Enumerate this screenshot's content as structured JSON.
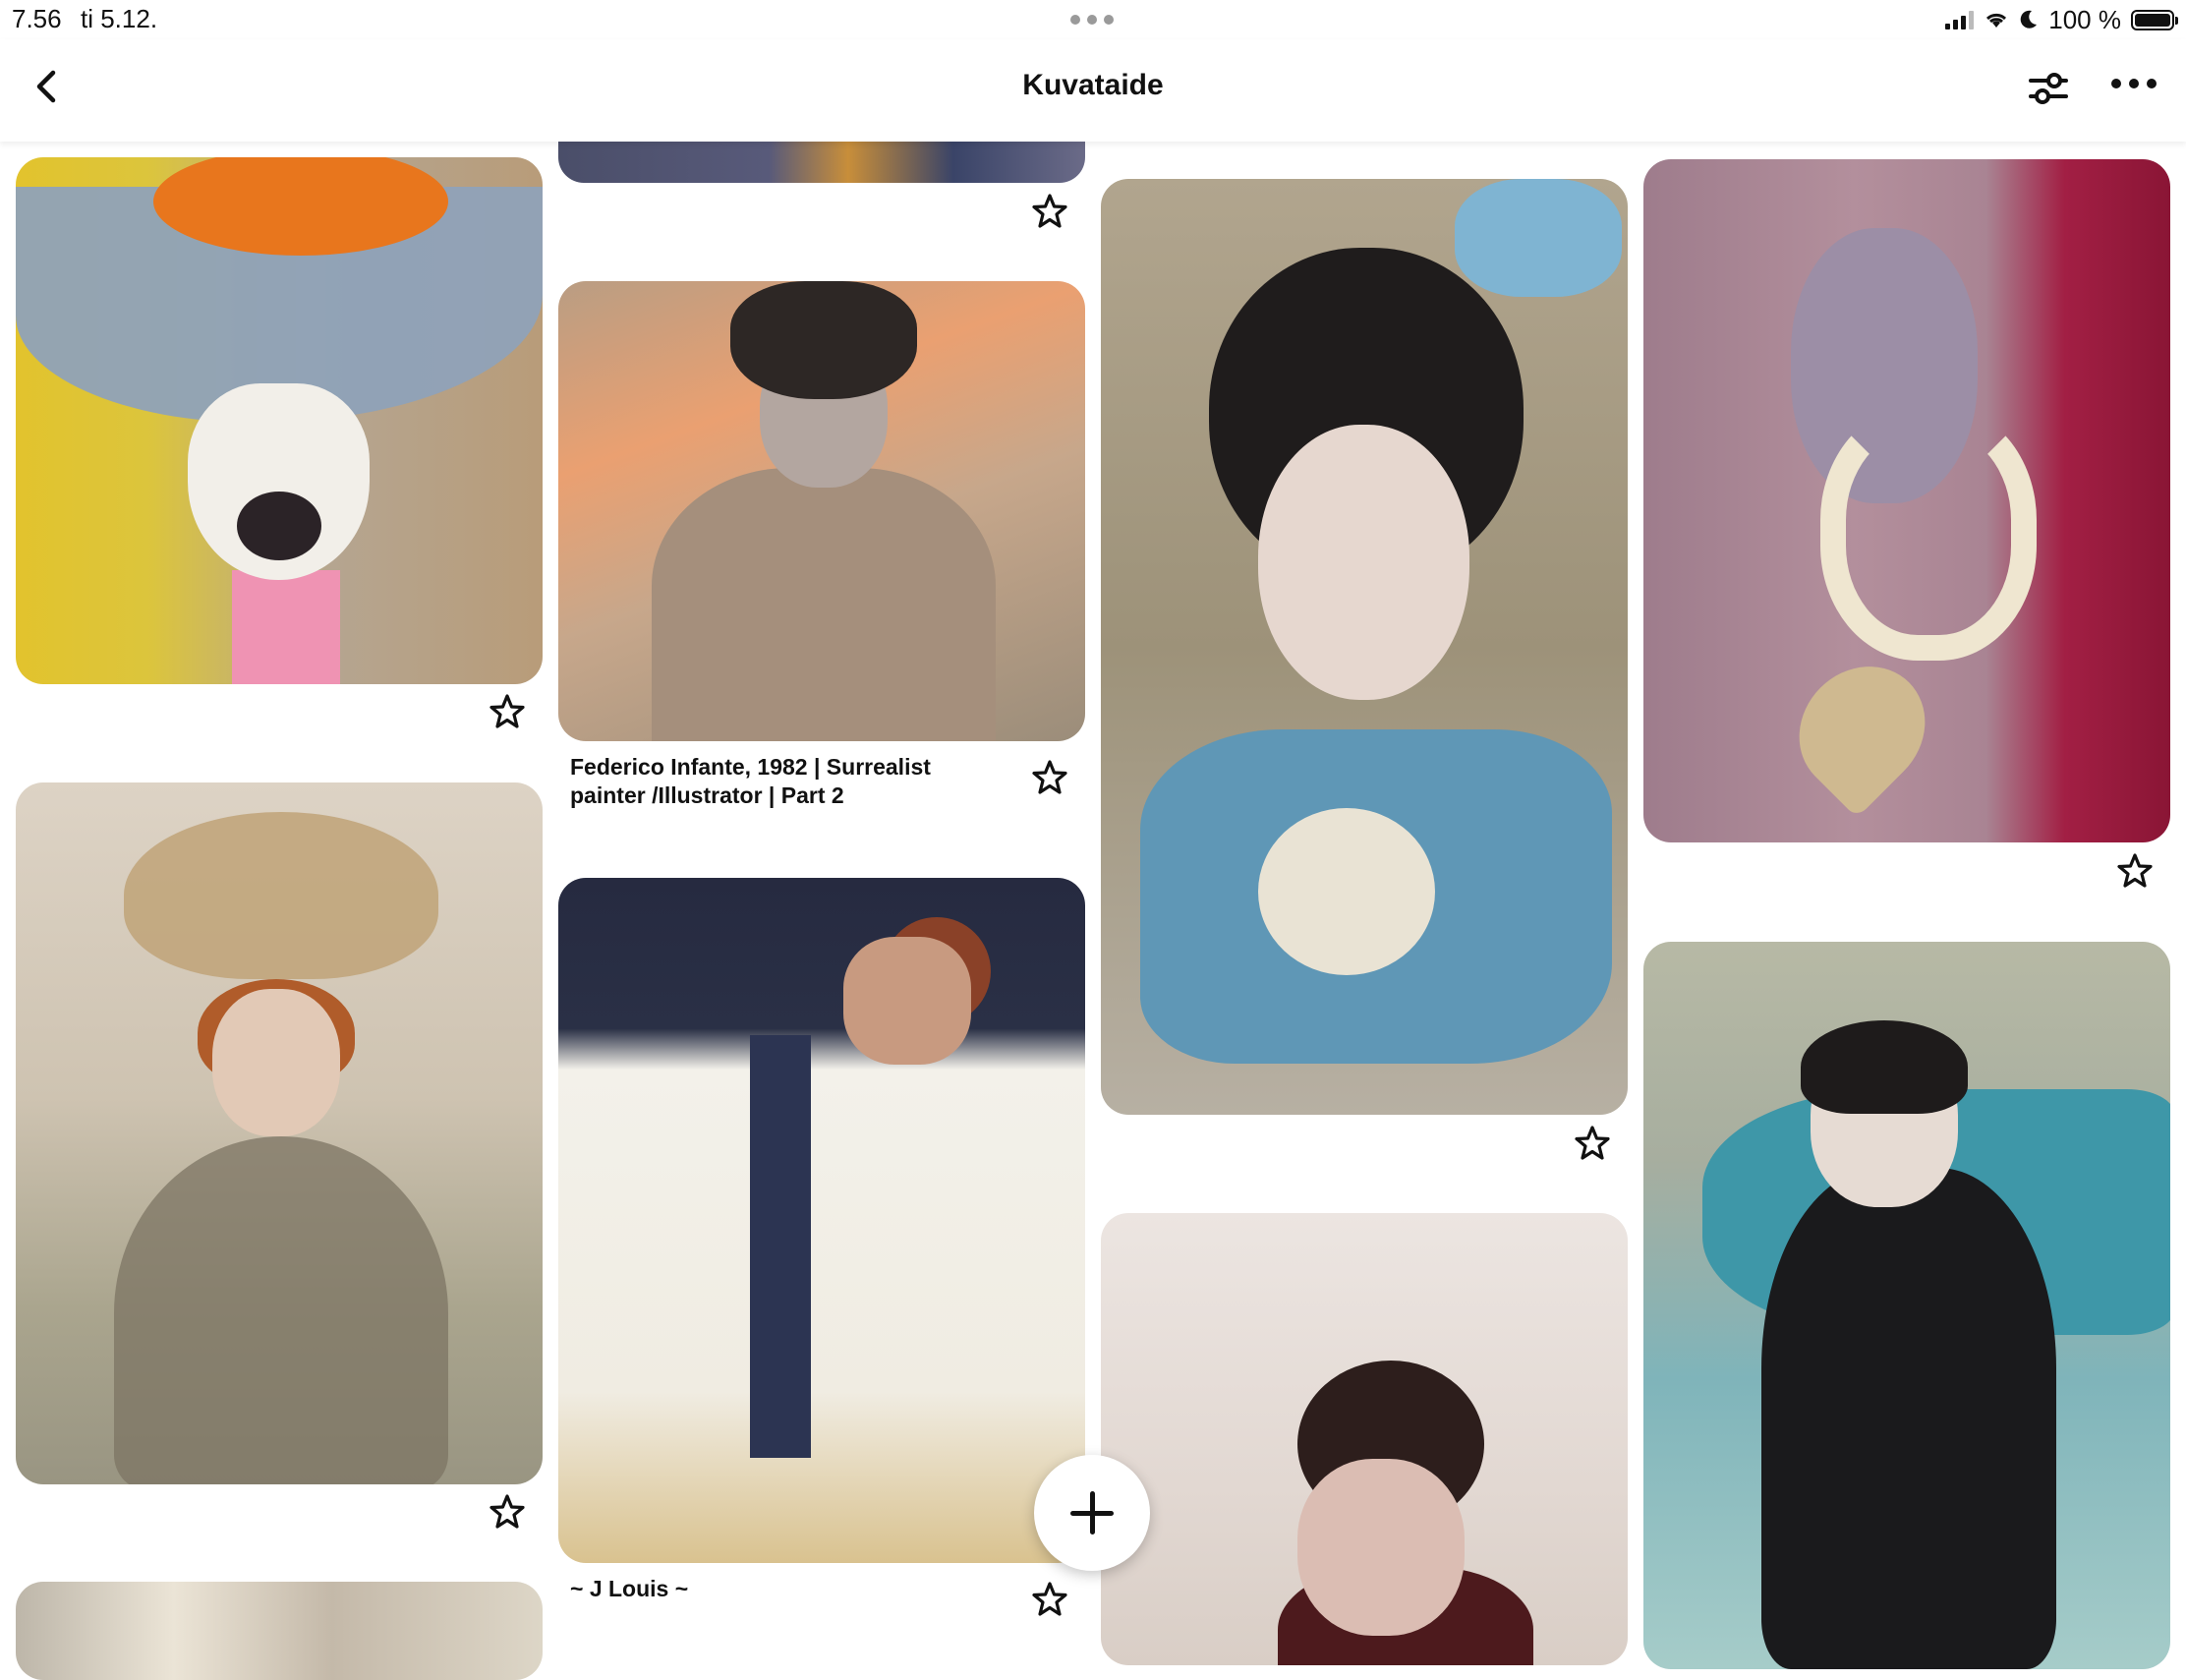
{
  "status_bar": {
    "time": "7.56",
    "date": "ti 5.12.",
    "battery_percent": "100 %"
  },
  "header": {
    "title": "Kuvataide",
    "back_icon": "chevron-left-icon",
    "filter_icon": "sliders-icon",
    "more_icon": "ellipsis-icon"
  },
  "pins": {
    "federico": {
      "caption": "Federico Infante, 1982 | Surrealist painter /Illustrator | Part 2"
    },
    "jlouis": {
      "caption": "~ J Louis ~"
    }
  },
  "fab": {
    "icon": "plus-icon"
  },
  "colors": {
    "text": "#111111",
    "background": "#ffffff"
  }
}
